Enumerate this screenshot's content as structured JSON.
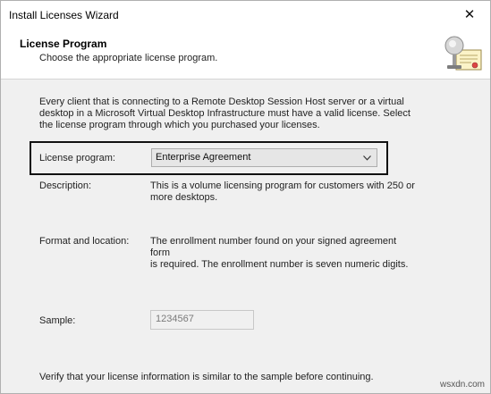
{
  "window": {
    "title": "Install Licenses Wizard",
    "close_symbol": "✕"
  },
  "header": {
    "title": "License Program",
    "subtitle": "Choose the appropriate license program.",
    "icon": "license-certificate-icon"
  },
  "body": {
    "intro_line1": "Every client that is connecting to a Remote Desktop Session Host server or a virtual",
    "intro_line2": "desktop in a Microsoft Virtual Desktop Infrastructure must have a valid license. Select",
    "intro_line3": "the license program through which you purchased your licenses."
  },
  "license_program": {
    "label": "License program:",
    "selected": "Enterprise Agreement"
  },
  "description": {
    "label": "Description:",
    "line1": "This is a volume licensing program for customers with 250 or",
    "line2": "more desktops."
  },
  "format": {
    "label": "Format and location:",
    "line1": "The enrollment number found on your signed agreement form",
    "line2": "is required. The enrollment number is seven numeric digits."
  },
  "sample": {
    "label": "Sample:",
    "value": "1234567"
  },
  "footer": {
    "text": "Verify that your license information is similar to the sample before continuing."
  },
  "watermark": "wsxdn.com"
}
